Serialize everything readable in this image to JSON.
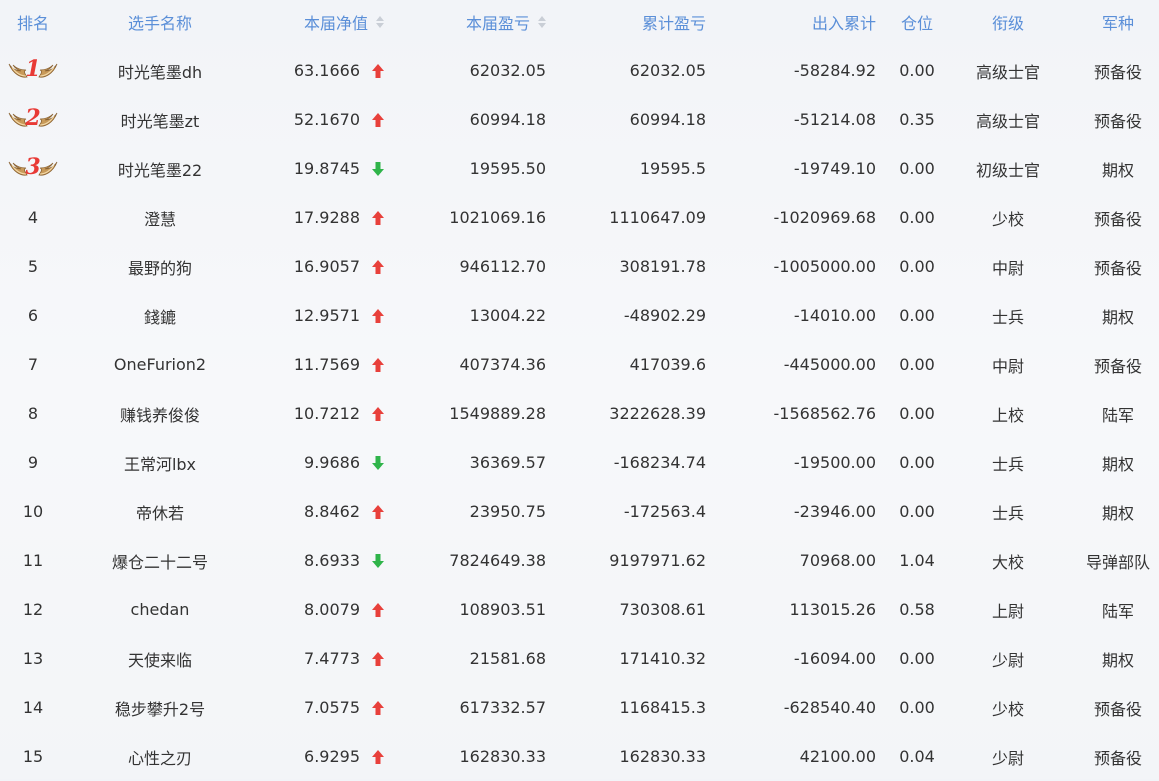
{
  "headers": {
    "rank": "排名",
    "name": "选手名称",
    "nav": "本届净值",
    "period_pnl": "本届盈亏",
    "total_pnl": "累计盈亏",
    "flow": "出入累计",
    "position": "仓位",
    "rank_title": "衔级",
    "arm": "军种"
  },
  "colors": {
    "header_text": "#5b8fd8",
    "up_arrow": "#e8403b",
    "down_arrow": "#2fb44a",
    "medal_number": "#e83a36"
  },
  "rows": [
    {
      "rank": "1",
      "medal": true,
      "name": "时光笔墨dh",
      "nav": "63.1666",
      "trend": "up",
      "period_pnl": "62032.05",
      "total_pnl": "62032.05",
      "flow": "-58284.92",
      "position": "0.00",
      "rank_title": "高级士官",
      "arm": "预备役"
    },
    {
      "rank": "2",
      "medal": true,
      "name": "时光笔墨zt",
      "nav": "52.1670",
      "trend": "up",
      "period_pnl": "60994.18",
      "total_pnl": "60994.18",
      "flow": "-51214.08",
      "position": "0.35",
      "rank_title": "高级士官",
      "arm": "预备役"
    },
    {
      "rank": "3",
      "medal": true,
      "name": "时光笔墨22",
      "nav": "19.8745",
      "trend": "down",
      "period_pnl": "19595.50",
      "total_pnl": "19595.5",
      "flow": "-19749.10",
      "position": "0.00",
      "rank_title": "初级士官",
      "arm": "期权"
    },
    {
      "rank": "4",
      "medal": false,
      "name": "澄慧",
      "nav": "17.9288",
      "trend": "up",
      "period_pnl": "1021069.16",
      "total_pnl": "1110647.09",
      "flow": "-1020969.68",
      "position": "0.00",
      "rank_title": "少校",
      "arm": "预备役"
    },
    {
      "rank": "5",
      "medal": false,
      "name": "最野的狗",
      "nav": "16.9057",
      "trend": "up",
      "period_pnl": "946112.70",
      "total_pnl": "308191.78",
      "flow": "-1005000.00",
      "position": "0.00",
      "rank_title": "中尉",
      "arm": "预备役"
    },
    {
      "rank": "6",
      "medal": false,
      "name": "錢鏕",
      "nav": "12.9571",
      "trend": "up",
      "period_pnl": "13004.22",
      "total_pnl": "-48902.29",
      "flow": "-14010.00",
      "position": "0.00",
      "rank_title": "士兵",
      "arm": "期权"
    },
    {
      "rank": "7",
      "medal": false,
      "name": "OneFurion2",
      "nav": "11.7569",
      "trend": "up",
      "period_pnl": "407374.36",
      "total_pnl": "417039.6",
      "flow": "-445000.00",
      "position": "0.00",
      "rank_title": "中尉",
      "arm": "预备役"
    },
    {
      "rank": "8",
      "medal": false,
      "name": "赚钱养俊俊",
      "nav": "10.7212",
      "trend": "up",
      "period_pnl": "1549889.28",
      "total_pnl": "3222628.39",
      "flow": "-1568562.76",
      "position": "0.00",
      "rank_title": "上校",
      "arm": "陆军"
    },
    {
      "rank": "9",
      "medal": false,
      "name": "王常河lbx",
      "nav": "9.9686",
      "trend": "down",
      "period_pnl": "36369.57",
      "total_pnl": "-168234.74",
      "flow": "-19500.00",
      "position": "0.00",
      "rank_title": "士兵",
      "arm": "期权"
    },
    {
      "rank": "10",
      "medal": false,
      "name": "帝休若",
      "nav": "8.8462",
      "trend": "up",
      "period_pnl": "23950.75",
      "total_pnl": "-172563.4",
      "flow": "-23946.00",
      "position": "0.00",
      "rank_title": "士兵",
      "arm": "期权"
    },
    {
      "rank": "11",
      "medal": false,
      "name": "爆仓二十二号",
      "nav": "8.6933",
      "trend": "down",
      "period_pnl": "7824649.38",
      "total_pnl": "9197971.62",
      "flow": "70968.00",
      "position": "1.04",
      "rank_title": "大校",
      "arm": "导弹部队"
    },
    {
      "rank": "12",
      "medal": false,
      "name": "chedan",
      "nav": "8.0079",
      "trend": "up",
      "period_pnl": "108903.51",
      "total_pnl": "730308.61",
      "flow": "113015.26",
      "position": "0.58",
      "rank_title": "上尉",
      "arm": "陆军"
    },
    {
      "rank": "13",
      "medal": false,
      "name": "天使来临",
      "nav": "7.4773",
      "trend": "up",
      "period_pnl": "21581.68",
      "total_pnl": "171410.32",
      "flow": "-16094.00",
      "position": "0.00",
      "rank_title": "少尉",
      "arm": "期权"
    },
    {
      "rank": "14",
      "medal": false,
      "name": "稳步攀升2号",
      "nav": "7.0575",
      "trend": "up",
      "period_pnl": "617332.57",
      "total_pnl": "1168415.3",
      "flow": "-628540.40",
      "position": "0.00",
      "rank_title": "少校",
      "arm": "预备役"
    },
    {
      "rank": "15",
      "medal": false,
      "name": "心性之刃",
      "nav": "6.9295",
      "trend": "up",
      "period_pnl": "162830.33",
      "total_pnl": "162830.33",
      "flow": "42100.00",
      "position": "0.04",
      "rank_title": "少尉",
      "arm": "预备役"
    }
  ]
}
